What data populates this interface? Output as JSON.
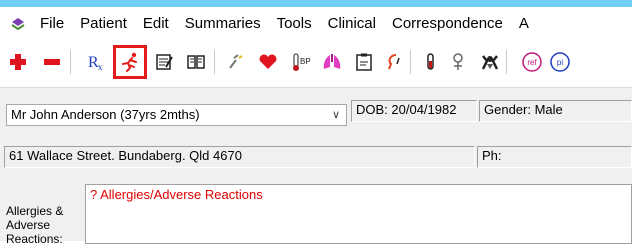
{
  "menu": {
    "items": [
      "File",
      "Patient",
      "Edit",
      "Summaries",
      "Tools",
      "Clinical",
      "Correspondence",
      "A"
    ]
  },
  "toolbar": {
    "buttons": [
      {
        "icon": "add-icon",
        "color": "#e0141e"
      },
      {
        "icon": "remove-icon",
        "color": "#e0141e"
      },
      {
        "icon": "prescription-icon",
        "label": "R",
        "sub": "x",
        "color": "#1f3fbf"
      },
      {
        "icon": "running-figure-icon",
        "selected": true,
        "color": "#e41b1b"
      },
      {
        "icon": "notepad-icon"
      },
      {
        "icon": "book-icon"
      },
      {
        "icon": "stethoscope-icon"
      },
      {
        "icon": "heart-icon",
        "color": "#e0141e"
      },
      {
        "icon": "blood-pressure-icon",
        "label": "BP"
      },
      {
        "icon": "lungs-icon",
        "color": "#e040c0"
      },
      {
        "icon": "clipboard-icon"
      },
      {
        "icon": "ear-icon",
        "color": "#e04020"
      },
      {
        "icon": "test-tube-icon",
        "color": "#c01818"
      },
      {
        "icon": "bandage-icon"
      },
      {
        "icon": "baby-icon"
      },
      {
        "icon": "referral-icon",
        "label": "ref",
        "color": "#c01878"
      },
      {
        "icon": "patient-info-icon",
        "label": "pi",
        "color": "#1f3fbf"
      }
    ]
  },
  "patient": {
    "selector_value": "Mr John Anderson (37yrs 2mths)",
    "dob": "DOB: 20/04/1982",
    "gender": "Gender: Male",
    "address": "61 Wallace Street. Bundaberg. Qld  4670",
    "phone_label": "Ph:"
  },
  "allergies": {
    "label_lines": [
      "Allergies &",
      "Adverse",
      "Reactions:"
    ],
    "text": "? Allergies/Adverse Reactions"
  }
}
